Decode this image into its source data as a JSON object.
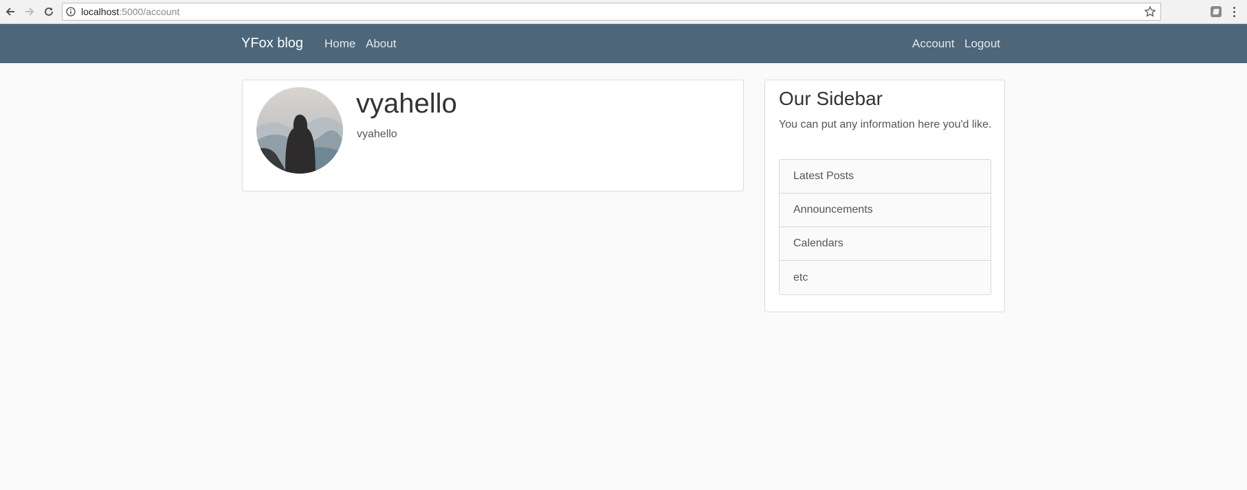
{
  "browser": {
    "url_host": "localhost",
    "url_path": ":5000/account"
  },
  "navbar": {
    "brand": "YFox blog",
    "left_links": [
      "Home",
      "About"
    ],
    "right_links": [
      "Account",
      "Logout"
    ],
    "background_color": "#4d6679"
  },
  "profile": {
    "username": "vyahello",
    "subtitle": "vyahello"
  },
  "sidebar": {
    "title": "Our Sidebar",
    "description": "You can put any information here you'd like.",
    "items": [
      "Latest Posts",
      "Announcements",
      "Calendars",
      "etc"
    ]
  }
}
